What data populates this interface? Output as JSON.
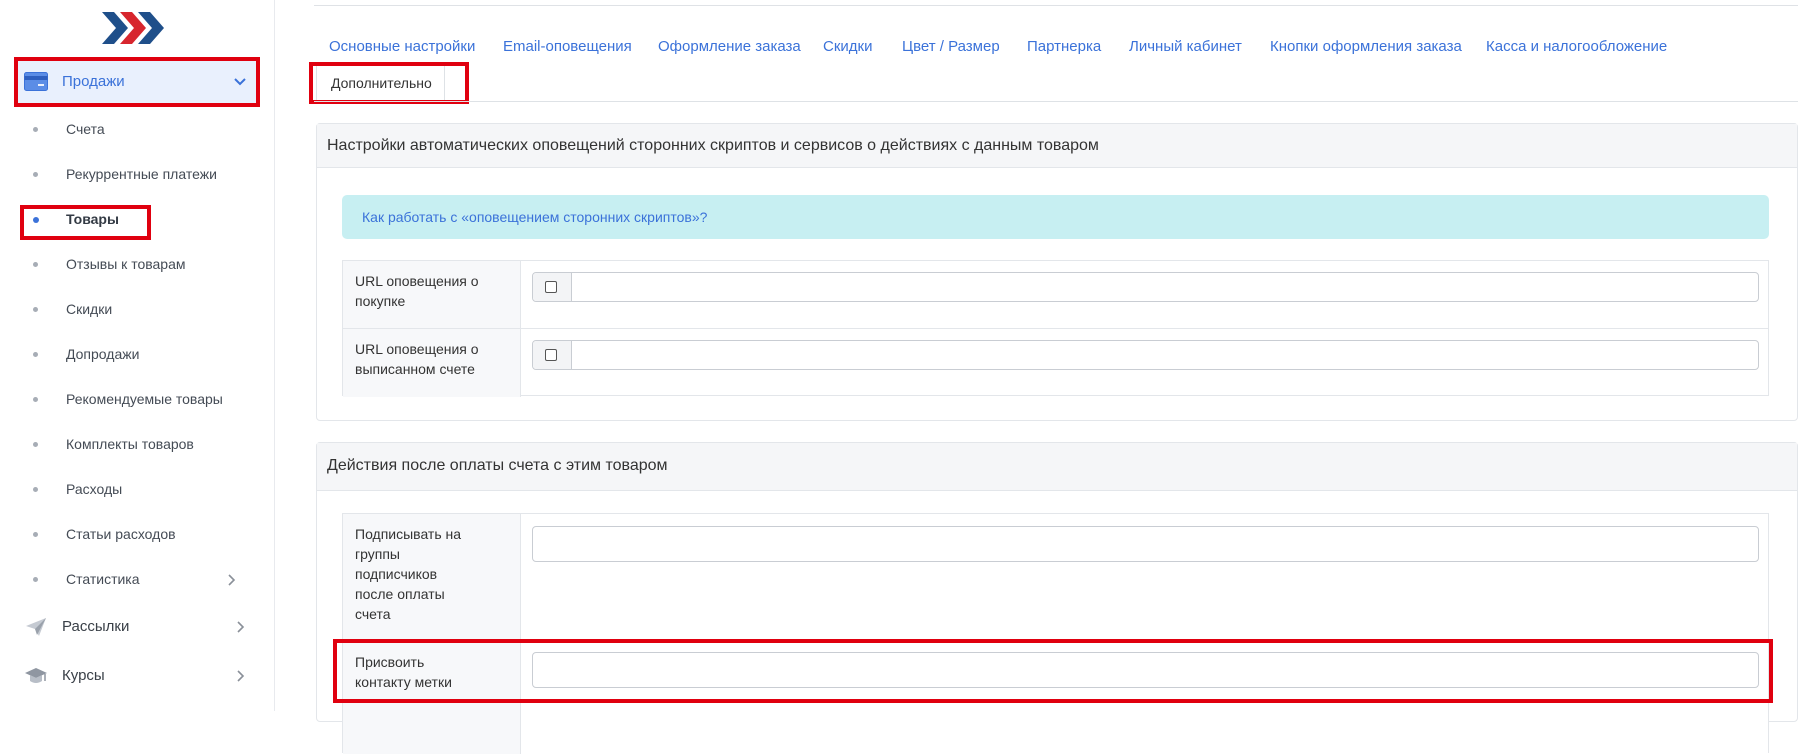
{
  "sidebar": {
    "sales": {
      "label": "Продажи",
      "icon": "credit-card-icon",
      "expanded": true
    },
    "sub_items": [
      {
        "label": "Счета"
      },
      {
        "label": "Рекуррентные платежи"
      },
      {
        "label": "Товары",
        "active": true
      },
      {
        "label": "Отзывы к товарам"
      },
      {
        "label": "Скидки"
      },
      {
        "label": "Допродажи"
      },
      {
        "label": "Рекомендуемые товары"
      },
      {
        "label": "Комплекты товаров"
      },
      {
        "label": "Расходы"
      },
      {
        "label": "Статьи расходов"
      },
      {
        "label": "Статистика",
        "has_children": true
      }
    ],
    "top_items": [
      {
        "label": "Рассылки",
        "icon": "paper-plane-icon"
      },
      {
        "label": "Курсы",
        "icon": "graduation-cap-icon"
      }
    ]
  },
  "tabs": [
    {
      "label": "Основные настройки"
    },
    {
      "label": "Email-оповещения"
    },
    {
      "label": "Оформление заказа"
    },
    {
      "label": "Скидки"
    },
    {
      "label": "Цвет / Размер"
    },
    {
      "label": "Партнерка"
    },
    {
      "label": "Личный кабинет"
    },
    {
      "label": "Кнопки оформления заказа"
    },
    {
      "label": "Касса и налогообложение"
    }
  ],
  "active_tab": {
    "label": "Дополнительно"
  },
  "panel_notify": {
    "title": "Настройки автоматических оповещений сторонних скриптов и сервисов о действиях с данным товаром",
    "info_link": "Как работать с «оповещением сторонних скриптов»?",
    "rows": [
      {
        "label_line1": "URL оповещения о",
        "label_line2": "покупке",
        "value": "",
        "checked": false
      },
      {
        "label_line1": "URL оповещения о",
        "label_line2": "выписанном счете",
        "value": "",
        "checked": false
      }
    ]
  },
  "panel_actions": {
    "title": "Действия после оплаты счета с этим товаром",
    "rows": [
      {
        "label_lines": [
          "Подписывать на",
          "группы",
          "подписчиков",
          "после оплаты",
          "счета"
        ],
        "value": ""
      },
      {
        "label_lines": [
          "Присвоить",
          "контакту метки"
        ],
        "value": ""
      }
    ]
  },
  "colors": {
    "accent": "#3b72d9",
    "highlight": "#e0000f",
    "info_bg": "#c7eff2",
    "sales_bg": "#e9f0fd"
  }
}
